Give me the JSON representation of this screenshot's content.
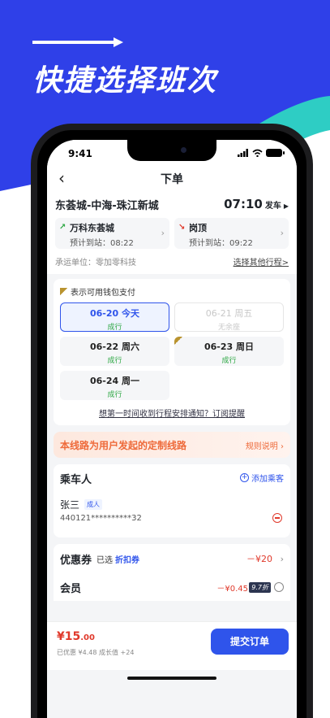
{
  "promo": {
    "headline": "快捷选择班次",
    "colors": {
      "blue": "#2f40e8",
      "teal": "#2ecdc4"
    }
  },
  "status_bar": {
    "time": "9:41"
  },
  "nav": {
    "back_icon": "chevron-left-icon",
    "title": "下单"
  },
  "route": {
    "name": "东荟城-中海-珠江新城",
    "depart_time": "07:10",
    "depart_label": "发车",
    "boarding": {
      "name": "万科东荟城",
      "eta": "预计到站：08:22"
    },
    "alighting": {
      "name": "岗顶",
      "eta": "预计到站：09:22"
    },
    "operator": "承运单位：零加零科技",
    "other_trips_link": "选择其他行程>"
  },
  "dates": {
    "wallet_text": "表示可用钱包支付",
    "items": [
      {
        "label": "06-20 今天",
        "status": "成行"
      },
      {
        "label": "06-21 周五",
        "status": "无余座"
      },
      {
        "label": "06-22 周六",
        "status": "成行"
      },
      {
        "label": "06-23 周日",
        "status": "成行"
      },
      {
        "label": "06-24 周一",
        "status": "成行"
      }
    ],
    "notify_link": "想第一时间收到行程安排通知？订阅提醒"
  },
  "banner": {
    "text": "本线路为用户发起的定制线路",
    "link": "规则说明 ›"
  },
  "passengers": {
    "title": "乘车人",
    "add_label": "添加乘客",
    "list": [
      {
        "name": "张三",
        "type": "成人",
        "id": "440121**********32"
      }
    ]
  },
  "coupon": {
    "title": "优惠券",
    "selected_text": "已选",
    "name": "折扣券",
    "amount": "－¥20"
  },
  "member": {
    "title": "会员",
    "price": "－¥0.45",
    "badge": "9.7折"
  },
  "order": {
    "total_main": "¥15",
    "total_decimal": ".00",
    "details": "已优惠 ¥4.48  成长值 +24",
    "submit_label": "提交订单"
  }
}
